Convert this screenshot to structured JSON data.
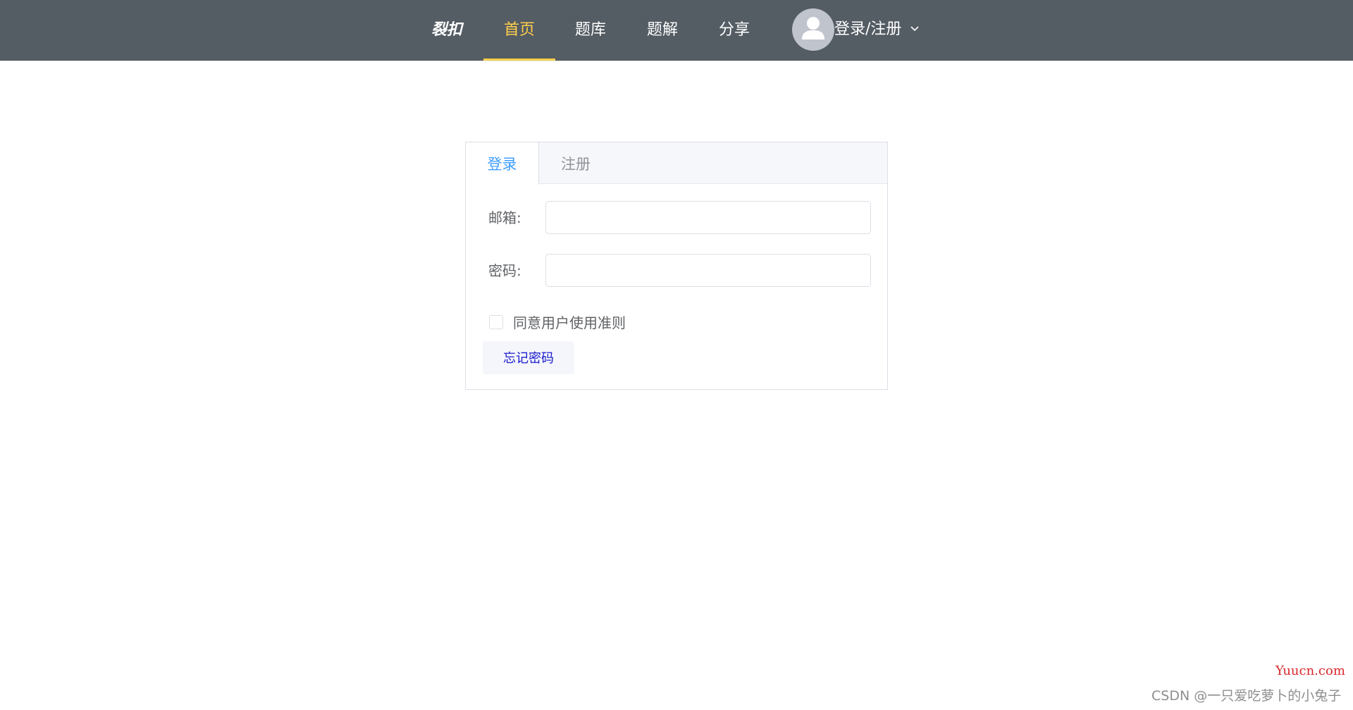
{
  "navbar": {
    "brand": "裂扣",
    "items": [
      {
        "label": "首页",
        "active": true
      },
      {
        "label": "题库",
        "active": false
      },
      {
        "label": "题解",
        "active": false
      },
      {
        "label": "分享",
        "active": false
      }
    ],
    "user": {
      "label": "登录/注册",
      "avatar_icon": "user-avatar-icon",
      "dropdown_icon": "chevron-down-icon"
    },
    "colors": {
      "background": "#545c64",
      "active_text": "#ffd04b",
      "text": "#ffffff"
    }
  },
  "login_card": {
    "tabs": [
      {
        "label": "登录",
        "active": true
      },
      {
        "label": "注册",
        "active": false
      }
    ],
    "fields": {
      "email": {
        "label": "邮箱:",
        "value": ""
      },
      "password": {
        "label": "密码:",
        "value": ""
      }
    },
    "agree": {
      "label": "同意用户使用准则",
      "checked": false
    },
    "forgot_password": "忘记密码",
    "colors": {
      "active_tab": "#409eff",
      "link": "#1a1acd"
    }
  },
  "watermarks": {
    "site": "Yuucn.com",
    "author": "CSDN @一只爱吃萝卜的小兔子"
  }
}
